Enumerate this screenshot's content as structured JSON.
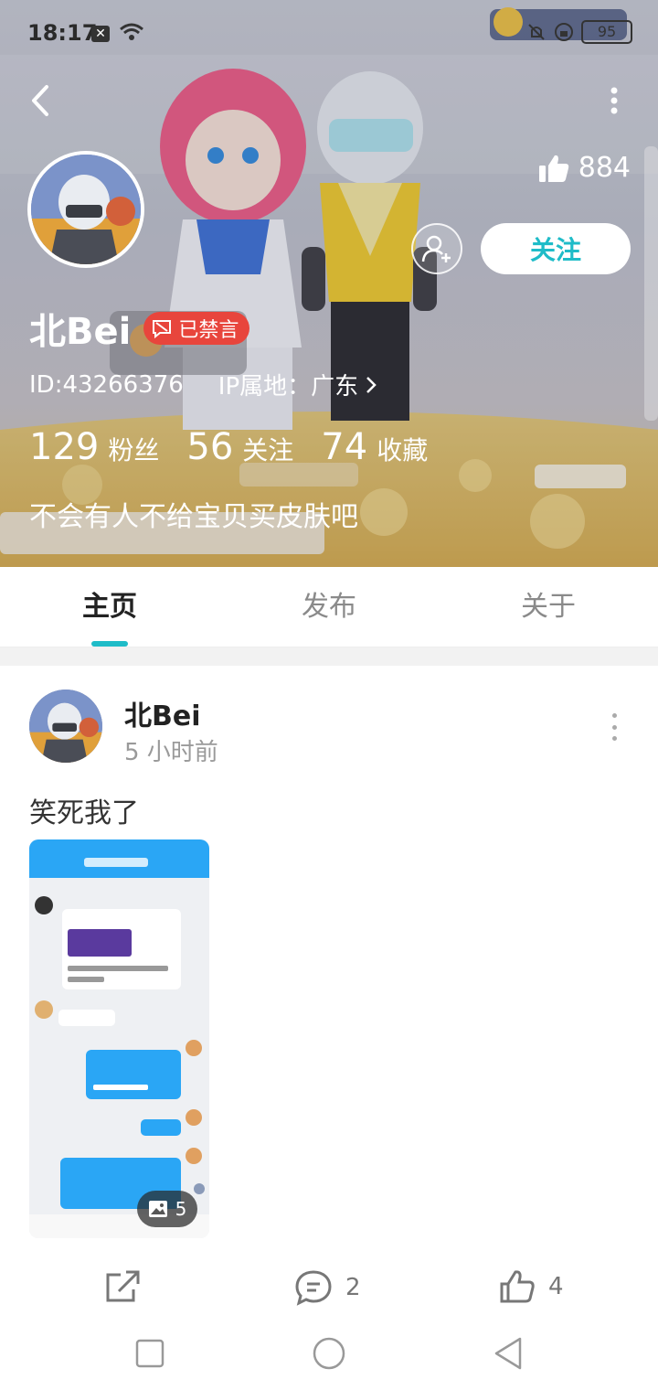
{
  "status_bar": {
    "time": "18:17",
    "battery": "95"
  },
  "profile": {
    "like_count": "884",
    "follow_label": "关注",
    "name": "北Bei",
    "muted_badge": "已禁言",
    "id_text": "ID:43266376",
    "ip_label": "IP属地：广东",
    "stats": [
      {
        "value": "129",
        "label": "粉丝"
      },
      {
        "value": "56",
        "label": "关注"
      },
      {
        "value": "74",
        "label": "收藏"
      }
    ],
    "bio": "不会有人不给宝贝买皮肤吧"
  },
  "tabs": [
    {
      "label": "主页",
      "active": true
    },
    {
      "label": "发布",
      "active": false
    },
    {
      "label": "关于",
      "active": false
    }
  ],
  "post": {
    "author": "北Bei",
    "time": "5 小时前",
    "text": "笑死我了",
    "image_count": "5",
    "comment_count": "2",
    "like_count": "4"
  },
  "colors": {
    "accent": "#1fbcc8",
    "muted_badge": "#e8453c"
  },
  "icons": {
    "back": "chevron-left-icon",
    "more": "more-vertical-icon",
    "thumb": "thumb-up-icon",
    "add_friend": "add-person-icon",
    "share": "share-icon",
    "comment": "comment-icon",
    "image": "image-icon"
  }
}
